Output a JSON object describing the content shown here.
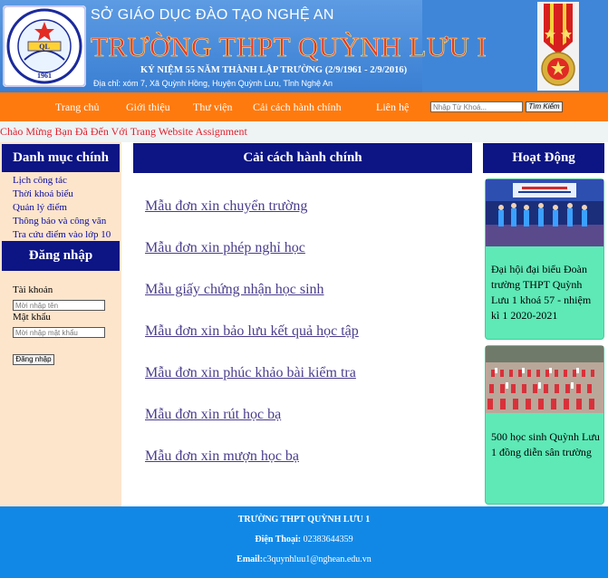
{
  "header": {
    "department": "SỞ GIÁO DỤC ĐÀO TẠO NGHỆ AN",
    "school_name": "TRƯỜNG THPT QUỲNH LƯU I",
    "anniversary": "KỶ NIỆM 55 NĂM THÀNH LẬP TRƯỜNG (2/9/1961 - 2/9/2016)",
    "address": "Địa chỉ: xóm 7, Xã Quỳnh Hồng,  Huyện Quỳnh Lưu, Tỉnh Nghệ An",
    "logo_year": "1961"
  },
  "nav": {
    "items": [
      "Trang chủ",
      "Giới thiệu",
      "Thư viện",
      "Cải cách hành chính",
      "Liên hệ"
    ],
    "search_placeholder": "Nhập Từ Khoá...",
    "search_button": "Tìm Kiếm"
  },
  "welcome": "Chào Mừng Bạn Đã Đến Với Trang Website Assignment",
  "sidebar": {
    "categories_title": "Danh mục chính",
    "categories": [
      "Lịch công tác",
      "Thời khoá biểu",
      "Quản lý điểm",
      "Thông báo và công văn",
      "Tra cứu điểm vào lớp 10"
    ],
    "login_title": "Đăng nhập",
    "username_label": "Tài khoản",
    "username_placeholder": "Mời nhập tên",
    "password_label": "Mật khẩu",
    "password_placeholder": "Mời nhập mật khẩu",
    "login_button": "Đăng nhập"
  },
  "main": {
    "title": "Cải cách hành chính",
    "forms": [
      "Mẫu đơn xin chuyển trường",
      "Mẫu đơn xin phép nghỉ học",
      "Mẫu giấy chứng nhận học sinh",
      "Mẫu đơn xin bảo lưu kết quả học tập",
      "Mẫu đơn xin phúc khảo bài kiểm tra",
      "Mẫu đơn xin rút học bạ",
      "Mẫu đơn xin mượn học bạ"
    ]
  },
  "activities": {
    "title": "Hoạt Động",
    "items": [
      "Đại hội đại biểu Đoàn trường THPT Quỳnh Lưu 1 khoá 57 - nhiệm kì 1 2020-2021",
      "500 học sinh Quỳnh Lưu 1 đồng diễn sân trường"
    ]
  },
  "footer": {
    "school": "TRƯỜNG THPT QUỲNH LƯU 1",
    "phone_label": "Điện Thoại:",
    "phone": "02383644359",
    "email_label": "Email:",
    "email": "c3quynhluu1@nghean.edu.vn"
  },
  "colors": {
    "navbar": "#ff7a0e",
    "heading_bg": "#0d1484",
    "sidebar_bg": "#fde5cc",
    "activity_card": "#5ee9b7",
    "footer": "#1288e6",
    "welcome_text": "#e0212d"
  },
  "icons": {
    "logo": "school-emblem-icon",
    "medal": "medal-icon"
  }
}
